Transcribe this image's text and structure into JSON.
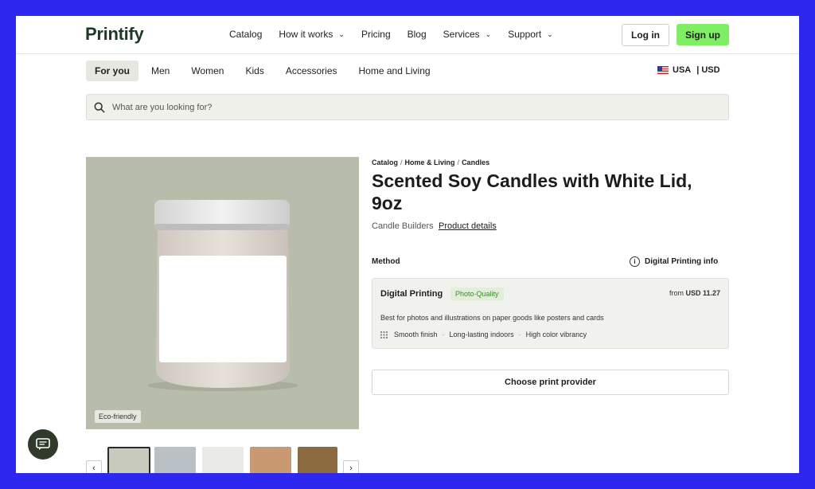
{
  "brand": {
    "logo": "Printify"
  },
  "nav": {
    "items": [
      {
        "label": "Catalog"
      },
      {
        "label": "How it works",
        "dropdown": true
      },
      {
        "label": "Pricing"
      },
      {
        "label": "Blog"
      },
      {
        "label": "Services",
        "dropdown": true
      },
      {
        "label": "Support",
        "dropdown": true
      }
    ],
    "login": "Log in",
    "signup": "Sign up"
  },
  "categories": [
    "For you",
    "Men",
    "Women",
    "Kids",
    "Accessories",
    "Home and Living"
  ],
  "region": {
    "country": "USA",
    "separator": "|",
    "currency": "USD"
  },
  "search": {
    "placeholder": "What are you looking for?"
  },
  "product": {
    "badge": "Eco-friendly",
    "breadcrumb": [
      "Catalog",
      "Home & Living",
      "Candles"
    ],
    "title": "Scented Soy Candles with White Lid, 9oz",
    "brand": "Candle Builders",
    "details_link": "Product details"
  },
  "method": {
    "label": "Method",
    "info_link": "Digital Printing info",
    "option": {
      "name": "Digital Printing",
      "badge": "Photo-Quality",
      "price_prefix": "from",
      "price": "USD 11.27",
      "description": "Best for photos and illustrations on paper goods like posters and cards",
      "features": [
        "Smooth finish",
        "Long-lasting indoors",
        "High color vibrancy"
      ]
    }
  },
  "cta": {
    "choose_provider": "Choose print provider"
  },
  "colors": {
    "background": "#2e27f0",
    "signup": "#7fee64",
    "logo": "#1e3a25",
    "photo_bg": "#b8bcab"
  }
}
